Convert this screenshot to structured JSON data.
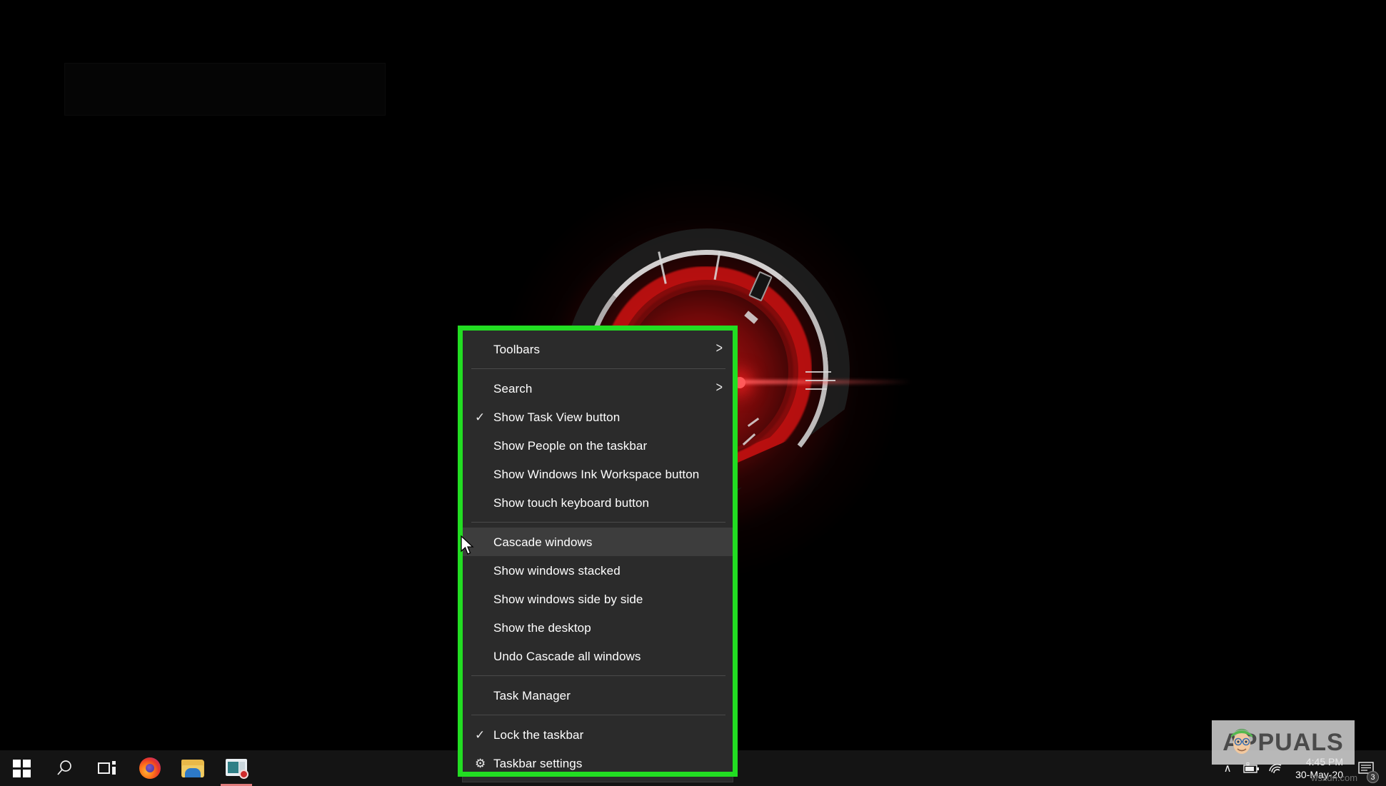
{
  "desktop": {
    "wallpaper_description": "dark razer-style radial emblem with red glow",
    "accent_green": "#22dd22",
    "menu_background": "#2b2b2b",
    "highlight_row_background": "#3d3d3d"
  },
  "context_menu": {
    "name": "taskbar-context-menu",
    "items": [
      {
        "label": "Toolbars",
        "glyph": "",
        "submenu": ">",
        "type": "submenu",
        "highlighted": false
      },
      {
        "type": "separator"
      },
      {
        "label": "Search",
        "glyph": "",
        "submenu": ">",
        "type": "submenu",
        "highlighted": false
      },
      {
        "label": "Show Task View button",
        "glyph": "✓",
        "type": "check",
        "checked": true,
        "highlighted": false
      },
      {
        "label": "Show People on the taskbar",
        "glyph": "",
        "type": "item",
        "highlighted": false
      },
      {
        "label": "Show Windows Ink Workspace button",
        "glyph": "",
        "type": "item",
        "highlighted": false
      },
      {
        "label": "Show touch keyboard button",
        "glyph": "",
        "type": "item",
        "highlighted": false
      },
      {
        "type": "separator"
      },
      {
        "label": "Cascade windows",
        "glyph": "",
        "type": "item",
        "highlighted": true
      },
      {
        "label": "Show windows stacked",
        "glyph": "",
        "type": "item",
        "highlighted": false
      },
      {
        "label": "Show windows side by side",
        "glyph": "",
        "type": "item",
        "highlighted": false
      },
      {
        "label": "Show the desktop",
        "glyph": "",
        "type": "item",
        "highlighted": false
      },
      {
        "label": "Undo Cascade all windows",
        "glyph": "",
        "type": "item",
        "highlighted": false
      },
      {
        "type": "separator"
      },
      {
        "label": "Task Manager",
        "glyph": "",
        "type": "item",
        "highlighted": false
      },
      {
        "type": "separator"
      },
      {
        "label": "Lock the taskbar",
        "glyph": "✓",
        "type": "check",
        "checked": true,
        "highlighted": false
      },
      {
        "label": "Taskbar settings",
        "glyph": "⚙",
        "type": "item",
        "highlighted": false
      }
    ]
  },
  "taskbar": {
    "buttons": [
      {
        "name": "start-button",
        "icon": "windows-logo-icon",
        "label": "Start"
      },
      {
        "name": "search-button",
        "icon": "search-icon",
        "label": "Search"
      },
      {
        "name": "task-view-button",
        "icon": "task-view-icon",
        "label": "Task View"
      },
      {
        "name": "firefox-button",
        "icon": "firefox-icon",
        "label": "Firefox"
      },
      {
        "name": "file-explorer-button",
        "icon": "folder-icon",
        "label": "File Explorer"
      },
      {
        "name": "snipping-tool-button",
        "icon": "snip-record-icon",
        "label": "Snip & Sketch",
        "active": true
      }
    ],
    "tray": {
      "show_hidden_icons": "∧",
      "battery_icon": "battery-icon",
      "network_icon": "wifi-icon",
      "time": "4:45 PM",
      "date": "30-May-20",
      "notification_count": "3"
    }
  },
  "watermark": {
    "text": "APPUALS",
    "site_credit": "wsxdn.com"
  }
}
